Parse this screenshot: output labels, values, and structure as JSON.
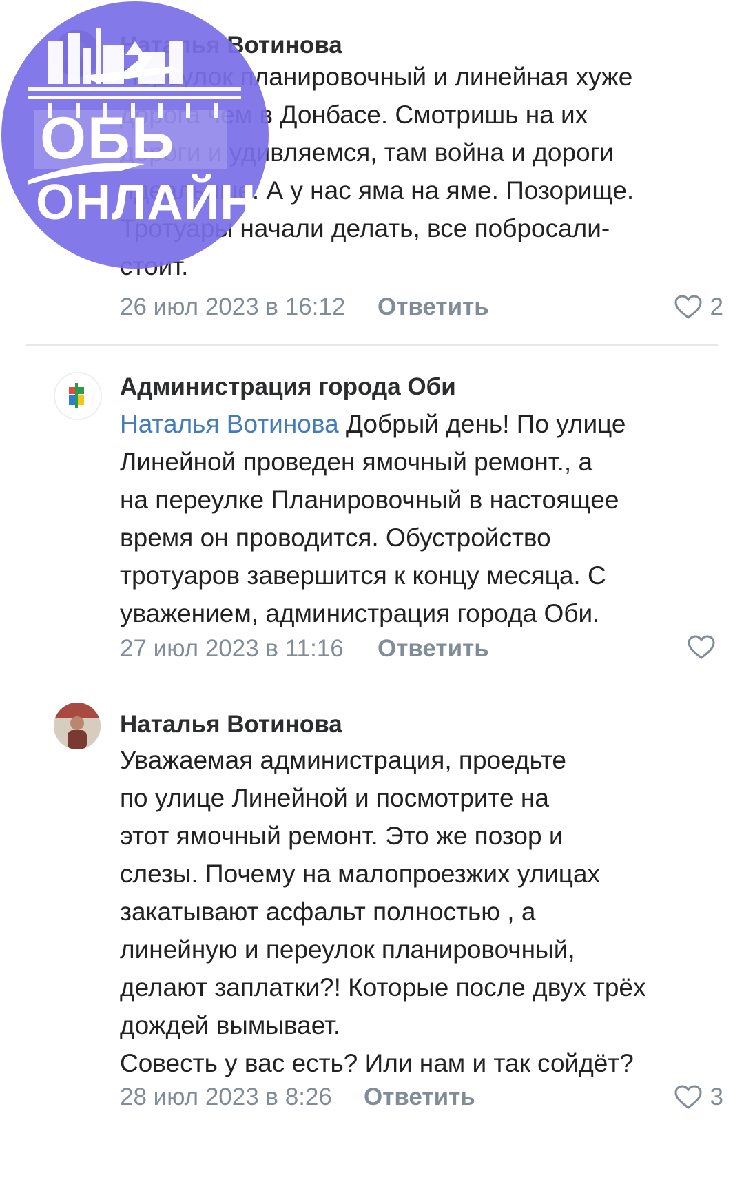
{
  "watermark": {
    "line1": "ОБЬ",
    "line2": "ОНЛАЙН",
    "color": "#7b6fe6"
  },
  "comments": [
    {
      "author": "Наталья Вотинова",
      "avatar_icon": "user-photo-avatar",
      "mention": "",
      "lines": [
        "Переулок планировочный и линейная хуже",
        "дорога чем в Донбасе. Смотришь на их",
        "дороги и удивляемся,  там война и дороги",
        "идеальные.  А у нас яма на яме. Позорище.",
        "Тротуары начали делать, все побросали-",
        "стоит."
      ],
      "date": "26 июл 2023 в 16:12",
      "reply_label": "Ответить",
      "likes": "2"
    },
    {
      "author": "Администрация города Оби",
      "avatar_icon": "city-emblem-avatar",
      "mention": "Наталья Вотинова",
      "lines": [
        "Добрый день! По улице",
        "Линейной проведен ямочный ремонт., а",
        "на переулке Планировочный в настоящее",
        "время он проводится. Обустройство",
        "тротуаров завершится к концу месяца. С",
        "уважением, администрация города Оби."
      ],
      "date": "27 июл 2023 в 11:16",
      "reply_label": "Ответить",
      "likes": ""
    },
    {
      "author": "Наталья Вотинова",
      "avatar_icon": "user-photo-avatar",
      "mention": "",
      "lines": [
        "Уважаемая администрация, проедьте",
        "по улице Линейной и посмотрите на",
        "этот ямочный ремонт. Это же позор и",
        "слезы. Почему на  малопроезжих улицах",
        "закатывают асфальт полностью , а",
        "линейную и переулок планировочный,",
        "делают заплатки?! Которые после двух трёх",
        "дождей вымывает.",
        "Совесть у вас есть? Или нам и так сойдёт?"
      ],
      "date": "28 июл 2023 в 8:26",
      "reply_label": "Ответить",
      "likes": "3"
    }
  ]
}
